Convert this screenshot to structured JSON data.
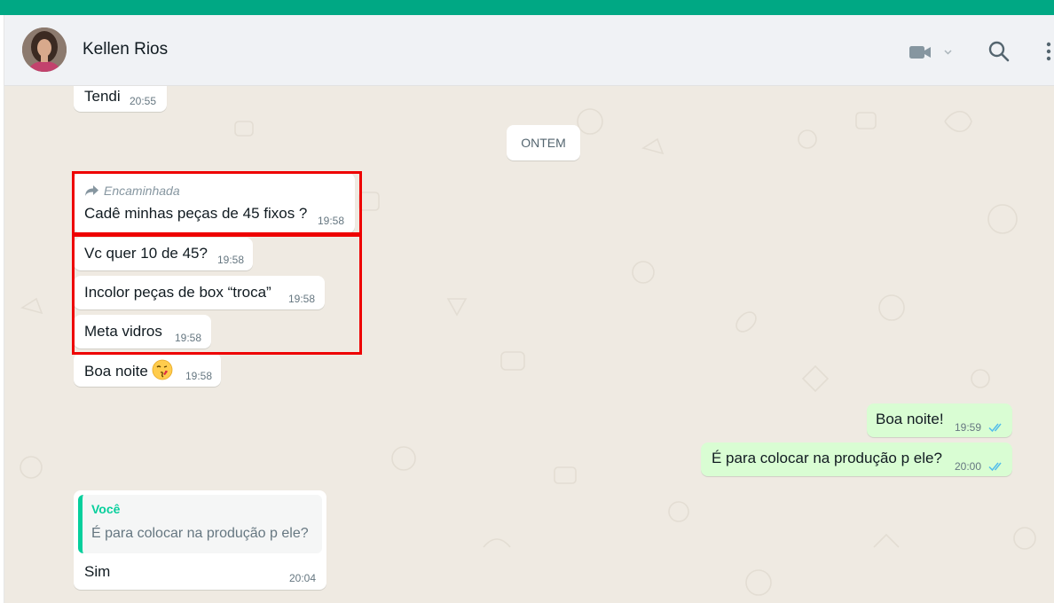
{
  "header": {
    "contact_name": "Kellen Rios"
  },
  "colors": {
    "brand_bar": "#00a884",
    "chat_background": "#efeae2",
    "incoming_bubble": "#ffffff",
    "outgoing_bubble": "#d9fdd3",
    "read_ticks": "#53bdeb",
    "highlight_box": "#ee0000",
    "quote_accent": "#06cf9c"
  },
  "icons": {
    "video": "video-camera-icon",
    "search": "search-icon",
    "menu": "menu-dots-icon",
    "forward": "forward-arrow-icon",
    "read_receipt": "double-check-icon",
    "emoji": "kissing-face-emoji"
  },
  "date_divider": "ONTEM",
  "messages": [
    {
      "direction": "in",
      "text": "Tendi",
      "time": "20:55"
    },
    {
      "direction": "in",
      "forwarded_label": "Encaminhada",
      "text": "Cadê minhas peças de 45 fixos ?",
      "time": "19:58"
    },
    {
      "direction": "in",
      "text": "Vc quer 10 de 45?",
      "time": "19:58"
    },
    {
      "direction": "in",
      "text": "Incolor peças de box “troca”",
      "time": "19:58"
    },
    {
      "direction": "in",
      "text": "Meta vidros",
      "time": "19:58"
    },
    {
      "direction": "in",
      "text": "Boa noite",
      "emoji": "😘",
      "time": "19:58"
    },
    {
      "direction": "out",
      "text": "Boa noite!",
      "time": "19:59",
      "status": "read"
    },
    {
      "direction": "out",
      "text": "É para colocar na produção p ele?",
      "time": "20:00",
      "status": "read"
    },
    {
      "direction": "in",
      "quote_author": "Você",
      "quote_text": "É para colocar na produção p ele?",
      "text": "Sim",
      "time": "20:04"
    }
  ]
}
